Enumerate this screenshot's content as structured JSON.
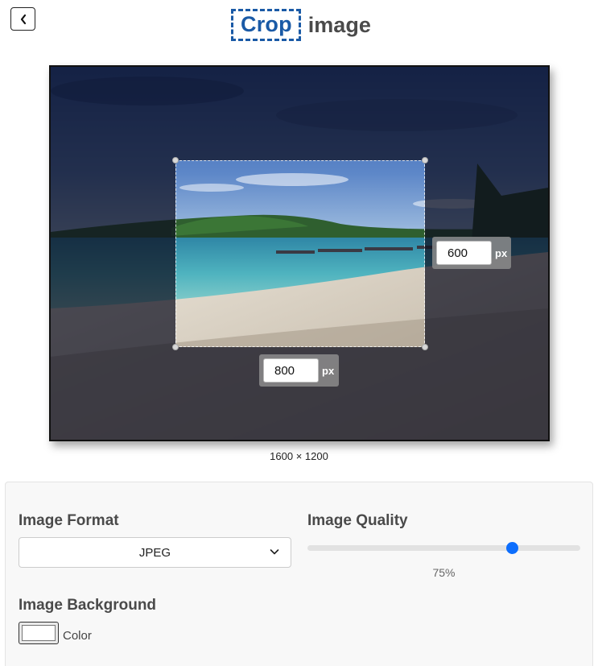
{
  "header": {
    "back_icon": "chevron-left-icon",
    "logo_boxed": "Crop",
    "logo_text": "image",
    "brand_color": "#1a5aa6"
  },
  "editor": {
    "crop_height_value": "600",
    "crop_width_value": "800",
    "unit_label": "px",
    "image_size": "1600 × 1200"
  },
  "settings": {
    "format_title": "Image Format",
    "format_selected": "JPEG",
    "quality_title": "Image Quality",
    "quality_value": "75%",
    "quality_percent": 75,
    "slider_color": "#0d6efd",
    "background_title": "Image Background",
    "background_label": "Color",
    "background_color": "#ffffff"
  }
}
